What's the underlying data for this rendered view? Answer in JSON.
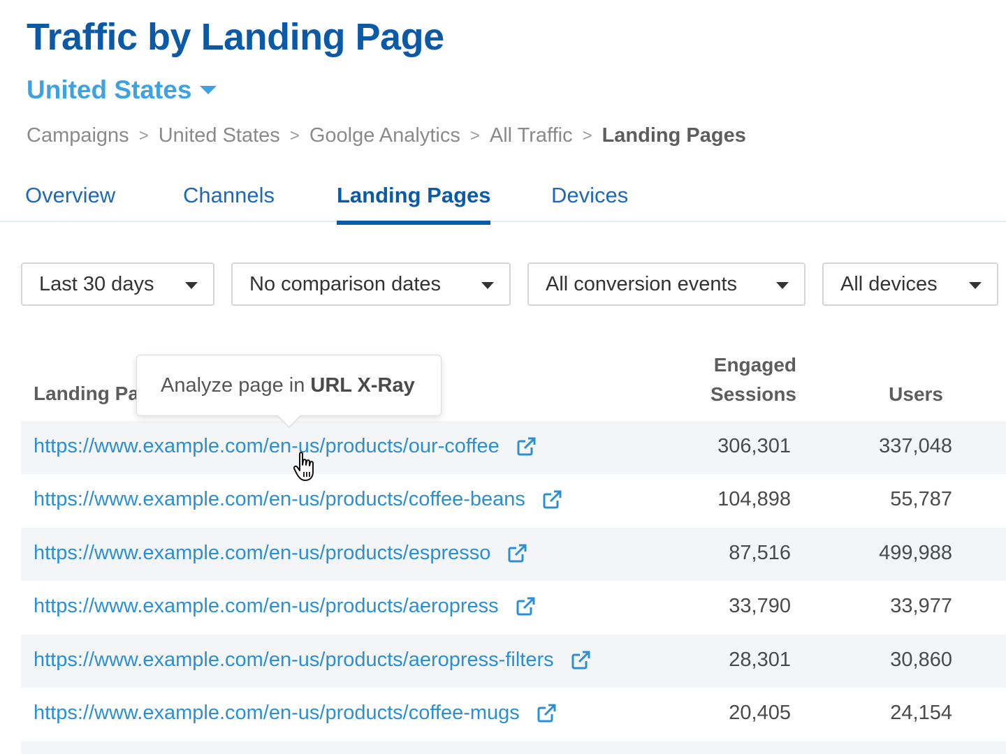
{
  "header": {
    "title": "Traffic by Landing Page",
    "country": "United States"
  },
  "breadcrumb": {
    "items": [
      "Campaigns",
      "United States",
      "Goolge Analytics",
      "All Traffic"
    ],
    "current": "Landing Pages",
    "separator": ">"
  },
  "tabs": [
    {
      "label": "Overview",
      "active": false
    },
    {
      "label": "Channels",
      "active": false
    },
    {
      "label": "Landing Pages",
      "active": true
    },
    {
      "label": "Devices",
      "active": false
    }
  ],
  "filters": {
    "date_range": "Last 30 days",
    "comparison": "No comparison dates",
    "conversion": "All conversion events",
    "devices": "All devices"
  },
  "table": {
    "columns": {
      "landing_page": "Landing Page",
      "engaged_sessions_line1": "Engaged",
      "engaged_sessions_line2": "Sessions",
      "users": "Users"
    },
    "rows": [
      {
        "url": "https://www.example.com/en-us/products/our-coffee",
        "engaged_sessions": "306,301",
        "users": "337,048"
      },
      {
        "url": "https://www.example.com/en-us/products/coffee-beans",
        "engaged_sessions": "104,898",
        "users": "55,787"
      },
      {
        "url": "https://www.example.com/en-us/products/espresso",
        "engaged_sessions": "87,516",
        "users": "499,988"
      },
      {
        "url": "https://www.example.com/en-us/products/aeropress",
        "engaged_sessions": "33,790",
        "users": "33,977"
      },
      {
        "url": "https://www.example.com/en-us/products/aeropress-filters",
        "engaged_sessions": "28,301",
        "users": "30,860"
      },
      {
        "url": "https://www.example.com/en-us/products/coffee-mugs",
        "engaged_sessions": "20,405",
        "users": "24,154"
      }
    ]
  },
  "tooltip": {
    "prefix": "Analyze page in",
    "strong": "URL X-Ray"
  },
  "icons": {
    "country_caret": "caret-down-icon",
    "dropdown_caret": "caret-down-icon",
    "external_link": "external-link-icon",
    "cursor": "hand-pointer-cursor-icon"
  },
  "colors": {
    "title": "#0b5aa8",
    "country": "#3fa2e0",
    "link": "#2b8fd4",
    "tab": "#1f68b8",
    "row_shade": "#f4f5f6"
  }
}
